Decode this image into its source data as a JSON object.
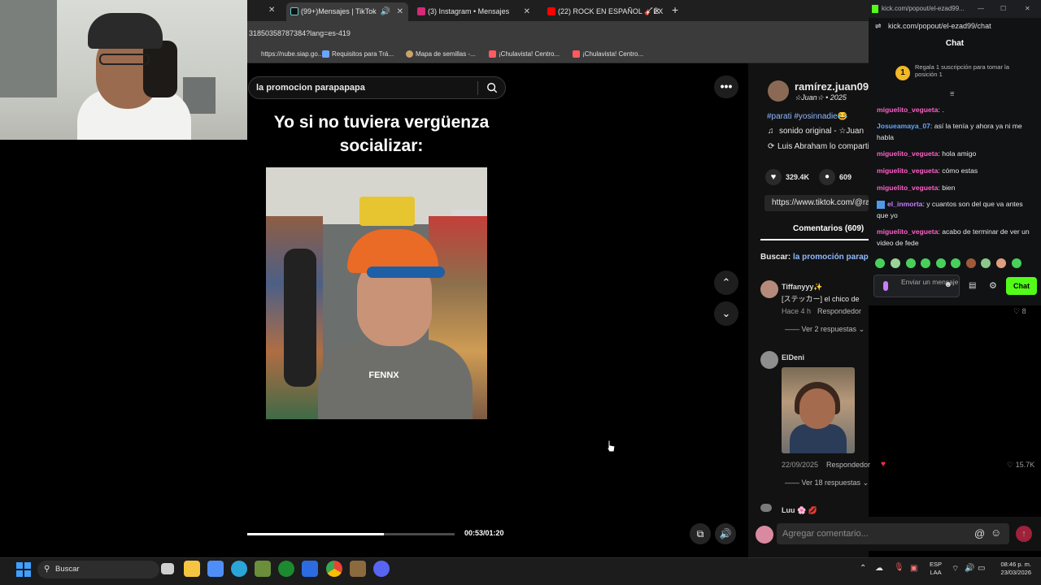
{
  "browser": {
    "tabs": [
      {
        "label": "(99+)Mensajes | TikTok",
        "active": true
      },
      {
        "label": "(3) Instagram • Mensajes",
        "active": false
      },
      {
        "label": "(22) ROCK EN ESPAÑOL 🎸ÉX",
        "active": false
      }
    ],
    "url_fragment": "31850358787384?lang=es-419",
    "bookmarks": [
      "https://nube.siap.go...",
      "Requisitos para Trá...",
      "Mapa de semillas -...",
      "¡Chulavista! Centro...",
      "¡Chulavista! Centro..."
    ]
  },
  "tiktok": {
    "search_value": "la promocion parapapapa",
    "video": {
      "caption": "Yo si no tuviera vergüenza socializar:",
      "watermark": "FENNX",
      "time": "00:53/01:20",
      "progress_fraction": 0.66
    },
    "post": {
      "author": "ramírez.juan09",
      "author_sub": "☆Juan☆ • 2025",
      "hashtags": "#parati #yosinnadie😂",
      "sound": "sonido original - ☆Juan",
      "shared_by": "Luis Abraham lo compartió",
      "likes": "329.4K",
      "comments_count": "609",
      "link": "https://www.tiktok.com/@ra",
      "comments_tab": "Comentarios (609)",
      "search_prefix": "Buscar:",
      "search_term": "la promoción parapap"
    },
    "comments": [
      {
        "user": "Tiffanyyy✨",
        "text": "[ステッカー] el chico de",
        "time": "Hace 4 h",
        "reply": "Respondedor",
        "likes": "8",
        "replies": "Ver 2 respuestas"
      },
      {
        "user": "ElDeni",
        "time": "22/09/2025",
        "reply": "Respondedor",
        "likes": "15.7K",
        "replies": "Ver 18 respuestas"
      },
      {
        "user": "Luu 🌸 💋"
      }
    ],
    "add_comment_placeholder": "Agregar comentario..."
  },
  "kick": {
    "top_url": "kick.com/popout/el-ezad99...",
    "url": "kick.com/popout/el-ezad99/chat",
    "title": "Chat",
    "banner_badge": "1",
    "banner": "Regala 1 suscripción para tomar la posición 1",
    "messages": [
      {
        "user": "miguelito_vegueta",
        "text": " .",
        "color": "#ff5fc8"
      },
      {
        "user": "Josueamaya_07",
        "text": " así la tenía y ahora ya ni me habla",
        "color": "#5fa8ff"
      },
      {
        "user": "miguelito_vegueta",
        "text": " hola amigo",
        "color": "#ff5fc8"
      },
      {
        "user": "miguelito_vegueta",
        "text": " cómo estas",
        "color": "#ff5fc8"
      },
      {
        "user": "miguelito_vegueta",
        "text": " bien",
        "color": "#ff5fc8"
      },
      {
        "user": "el_inmorta",
        "text": " y cuantos son del que va antes que yo",
        "color": "#c77dff"
      },
      {
        "user": "miguelito_vegueta",
        "text": " acabo de terminar de ver un video de fede",
        "color": "#ff5fc8"
      }
    ],
    "input_placeholder": "Enviar un mensaje",
    "chat_button": "Chat"
  },
  "taskbar": {
    "search": "Buscar",
    "lang": "ESP",
    "lang2": "LAA",
    "time": "08:46 p. m.",
    "date": "23/03/2026"
  }
}
